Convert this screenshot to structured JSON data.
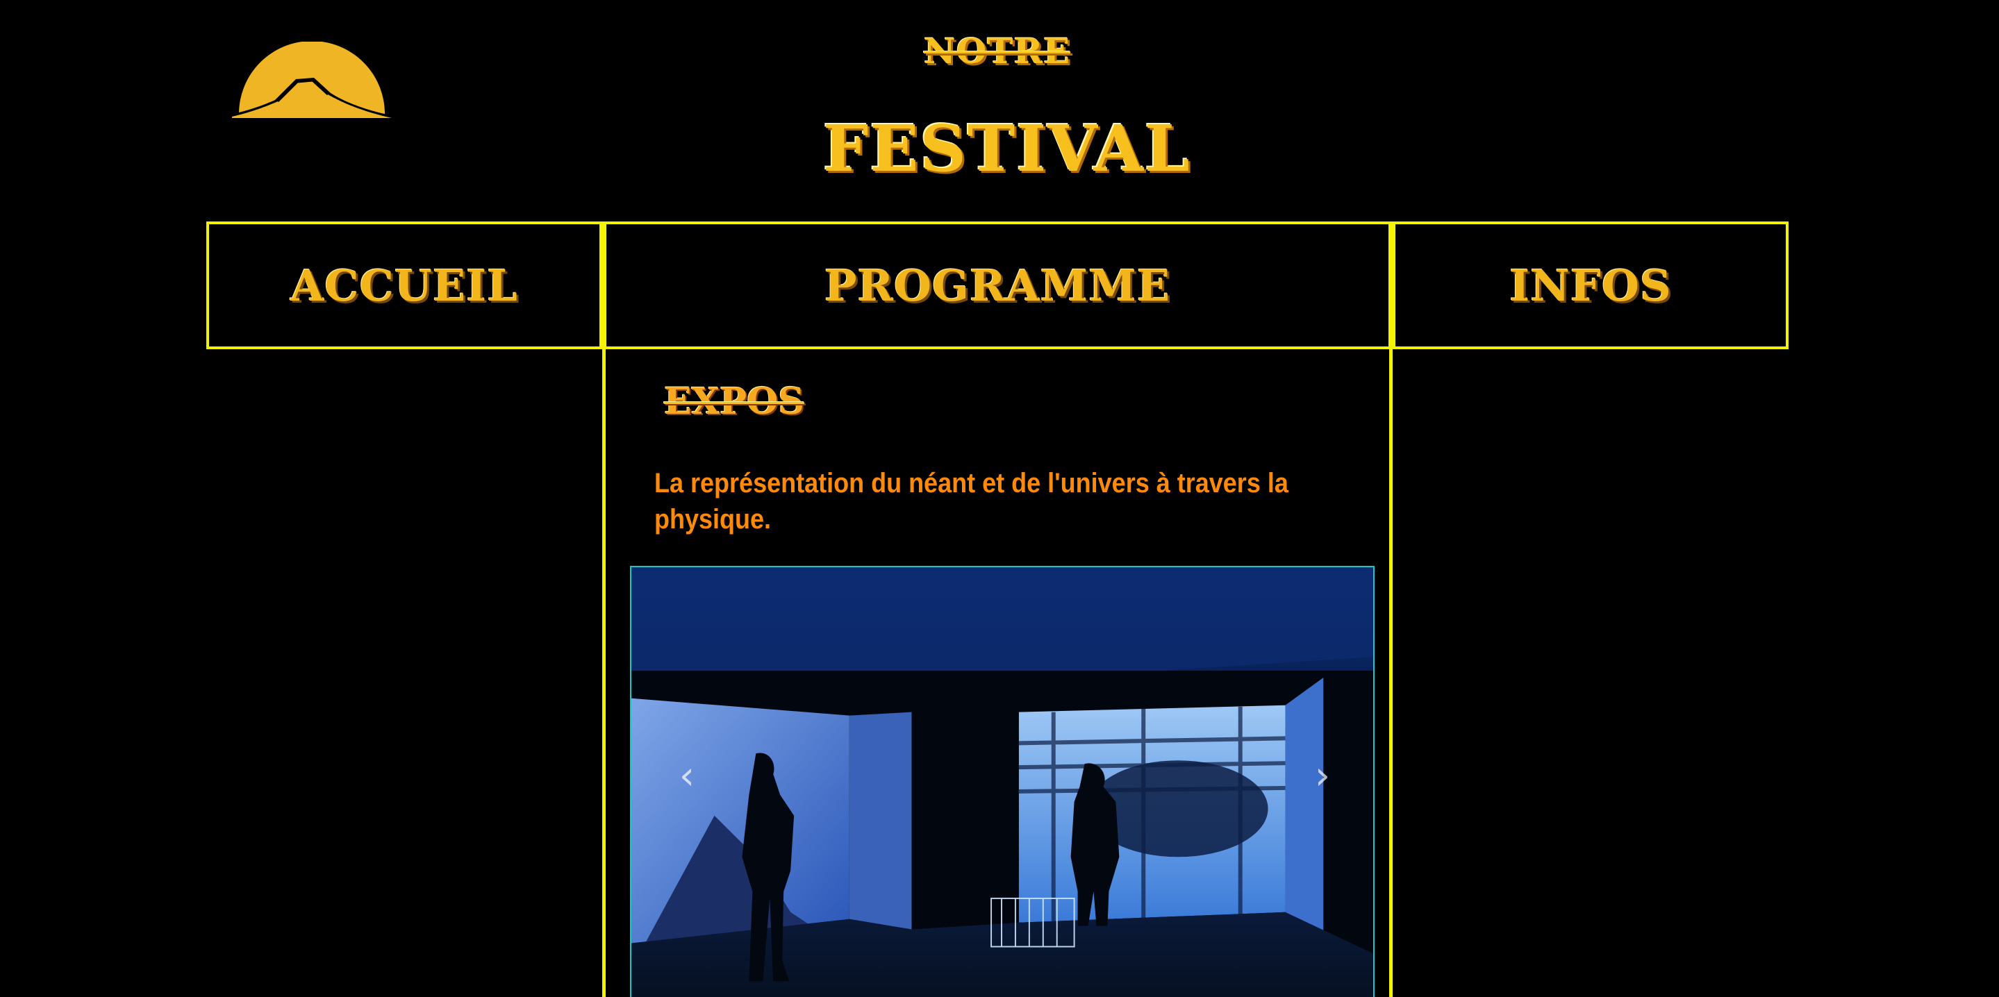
{
  "header": {
    "logo_icon": "sun-mountain-logo-icon",
    "title_small": "NOTRE",
    "title_big": "FESTIVAL"
  },
  "nav": {
    "items": [
      {
        "label": "ACCUEIL"
      },
      {
        "label": "PROGRAMME"
      },
      {
        "label": "INFOS"
      }
    ]
  },
  "section": {
    "title": "EXPOS",
    "description": "La représentation du néant et de l'univers à travers la physique."
  },
  "carousel": {
    "prev_icon": "chevron-left-icon",
    "next_icon": "chevron-right-icon"
  },
  "colors": {
    "background": "#000000",
    "border": "#f3f300",
    "title": "#f7c01e",
    "description": "#ff8a0a",
    "carousel_border": "#18c9c9"
  }
}
